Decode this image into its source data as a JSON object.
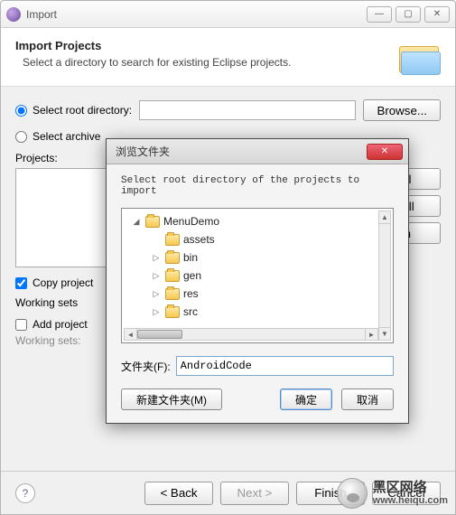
{
  "window": {
    "title": "Import"
  },
  "header": {
    "title": "Import Projects",
    "subtitle": "Select a directory to search for existing Eclipse projects."
  },
  "form": {
    "root_radio_label": "Select root directory:",
    "archive_radio_label": "Select archive",
    "root_path": "",
    "browse_label": "Browse...",
    "projects_label": "Projects:",
    "side_buttons": [
      "All",
      "t All",
      "sh"
    ],
    "copy_label": "Copy project",
    "working_sets_label": "Working sets",
    "add_project_label": "Add project",
    "working_sets_field_label": "Working sets:"
  },
  "footer": {
    "back": "< Back",
    "next": "Next >",
    "finish": "Finish",
    "cancel": "Cancel"
  },
  "dialog": {
    "title": "浏览文件夹",
    "message": "Select root directory of the projects to import",
    "tree": [
      {
        "indent": 0,
        "expander": "◢",
        "name": "MenuDemo"
      },
      {
        "indent": 1,
        "expander": "",
        "name": "assets"
      },
      {
        "indent": 1,
        "expander": "▷",
        "name": "bin"
      },
      {
        "indent": 1,
        "expander": "▷",
        "name": "gen"
      },
      {
        "indent": 1,
        "expander": "▷",
        "name": "res"
      },
      {
        "indent": 1,
        "expander": "▷",
        "name": "src"
      }
    ],
    "folder_label": "文件夹(F):",
    "folder_value": "AndroidCode",
    "new_folder": "新建文件夹(M)",
    "ok": "确定",
    "cancel": "取消"
  },
  "watermark": {
    "line1": "黑区网络",
    "line2": "www.heiqu.com"
  }
}
